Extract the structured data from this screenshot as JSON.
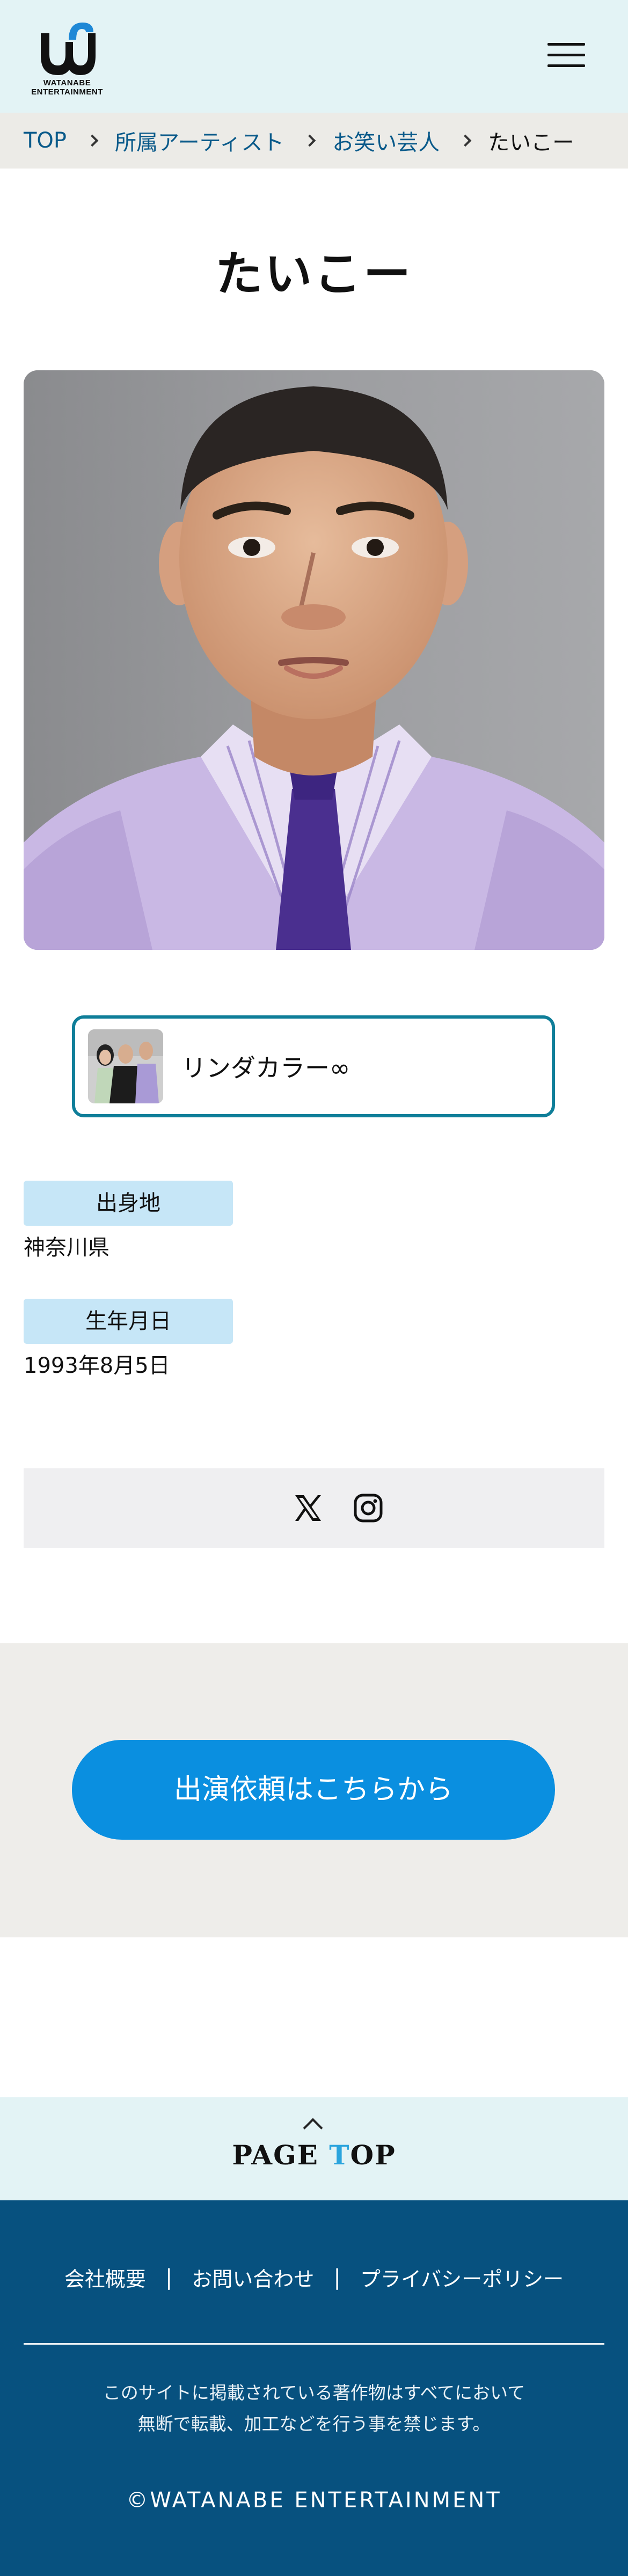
{
  "header": {
    "logo_text": "WATANABE ENTERTAINMENT",
    "menu_icon": "hamburger-icon"
  },
  "breadcrumb": {
    "items": [
      "TOP",
      "所属アーティスト",
      "お笑い芸人"
    ],
    "current": "たいこー"
  },
  "profile": {
    "name": "たいこー",
    "unit": "リンダカラー∞",
    "fields": [
      {
        "label": "出身地",
        "value": "神奈川県"
      },
      {
        "label": "生年月日",
        "value": "1993年8月5日"
      }
    ]
  },
  "sns": {
    "icons": [
      "x-icon",
      "instagram-icon"
    ]
  },
  "cta": {
    "label": "出演依頼はこちらから"
  },
  "page_top": {
    "prefix": "PAGE ",
    "accent": "T",
    "suffix": "OP"
  },
  "footer": {
    "links": [
      "会社概要",
      "お問い合わせ",
      "プライバシーポリシー"
    ],
    "separator": "|",
    "notice_line1": "このサイトに掲載されている著作物はすべてにおいて",
    "notice_line2": "無断で転載、加工などを行う事を禁じます。",
    "copyright": "©WATANABE ENTERTAINMENT"
  },
  "colors": {
    "header_bg": "#e3f3f5",
    "accent_blue": "#0a8fe0",
    "footer_bg": "#07517f",
    "label_bg": "#c6e6f7",
    "card_border": "#0f7e99"
  }
}
